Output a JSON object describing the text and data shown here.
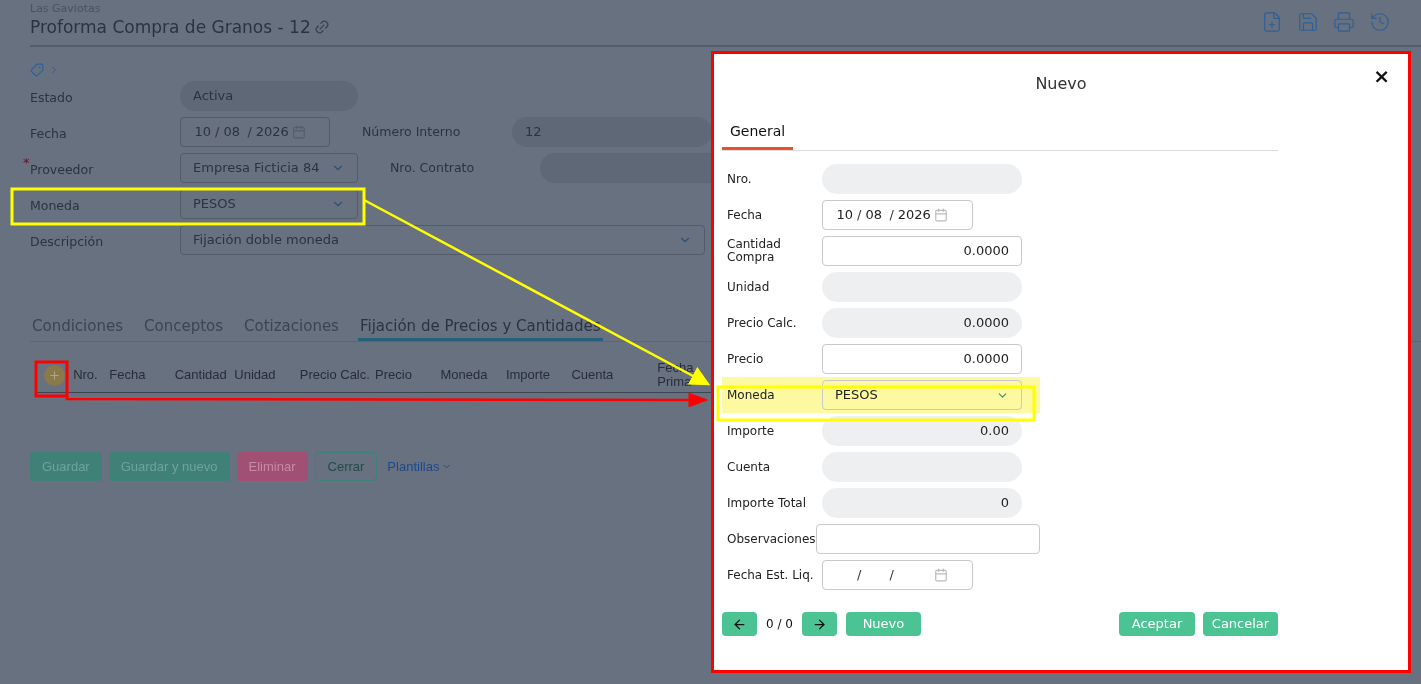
{
  "header": {
    "company": "Las Gaviotas",
    "title": "Proforma Compra de Granos - 12"
  },
  "form": {
    "rows": [
      {
        "label": "Estado",
        "required": false,
        "field": {
          "kind": "readonly",
          "value": "Activa"
        }
      },
      {
        "label": "Fecha",
        "required": false,
        "field": {
          "kind": "date",
          "day": "10",
          "month": "08",
          "year": "2026",
          "separator": "/"
        },
        "right": {
          "label": "Número Interno",
          "value": "12"
        }
      },
      {
        "label": "Proveedor",
        "required": true,
        "field": {
          "kind": "select",
          "value": "Empresa Ficticia 84"
        },
        "right": {
          "label": "Nro. Contrato"
        }
      },
      {
        "label": "Moneda",
        "required": false,
        "field": {
          "kind": "select",
          "value": "PESOS"
        }
      },
      {
        "label": "Descripción",
        "required": false,
        "field": {
          "kind": "wide-select",
          "value": "Fijación doble moneda"
        }
      }
    ],
    "required_mark": "*"
  },
  "tabs": [
    {
      "label": "Condiciones",
      "selected": false
    },
    {
      "label": "Conceptos",
      "selected": false
    },
    {
      "label": "Cotizaciones",
      "selected": false
    },
    {
      "label": "Fijación de Precios y Cantidades",
      "selected": true
    }
  ],
  "grid": {
    "columns": [
      "Nro.",
      "Fecha",
      "Cantidad",
      "Unidad",
      "Precio Calc.",
      "Precio",
      "Moneda",
      "Importe",
      "Cuenta",
      "Fecha Prima"
    ]
  },
  "buttons": [
    {
      "label": "Guardar",
      "kind": "primary"
    },
    {
      "label": "Guardar y nuevo",
      "kind": "primary"
    },
    {
      "label": "Eliminar",
      "kind": "danger"
    },
    {
      "label": "Cerrar",
      "kind": "outline"
    },
    {
      "label": "Plantillas",
      "kind": "link"
    }
  ],
  "dialog": {
    "title": "Nuevo",
    "close": "×",
    "tabs": [
      {
        "label": "General",
        "selected": true
      }
    ],
    "fields": [
      {
        "label": "Nro.",
        "kind": "readonly",
        "highlighted": false
      },
      {
        "label": "Fecha",
        "kind": "date",
        "day": "10",
        "month": "08",
        "year": "2026",
        "separator": "/",
        "highlighted": false
      },
      {
        "label": "Cantidad Compra",
        "kind": "input",
        "value": "0.0000",
        "highlighted": false
      },
      {
        "label": "Unidad",
        "kind": "readonly",
        "highlighted": false
      },
      {
        "label": "Precio Calc.",
        "kind": "readonly",
        "value": "0.0000",
        "highlighted": false
      },
      {
        "label": "Precio",
        "kind": "input",
        "value": "0.0000",
        "highlighted": false
      },
      {
        "label": "Moneda",
        "kind": "select",
        "value": "PESOS",
        "highlighted": true
      },
      {
        "label": "Importe",
        "kind": "readonly",
        "value": "0.00",
        "highlighted": false
      },
      {
        "label": "Cuenta",
        "kind": "readonly",
        "highlighted": false
      },
      {
        "label": "Importe Total",
        "kind": "readonly",
        "value": "0",
        "highlighted": false
      },
      {
        "label": "Observaciones",
        "kind": "text",
        "highlighted": false
      },
      {
        "label": "Fecha Est. Liq.",
        "kind": "date",
        "separator": "/",
        "highlighted": false
      }
    ],
    "pager": "0 / 0",
    "new_button": "Nuevo",
    "accept_button": "Aceptar",
    "cancel_button": "Cancelar"
  }
}
